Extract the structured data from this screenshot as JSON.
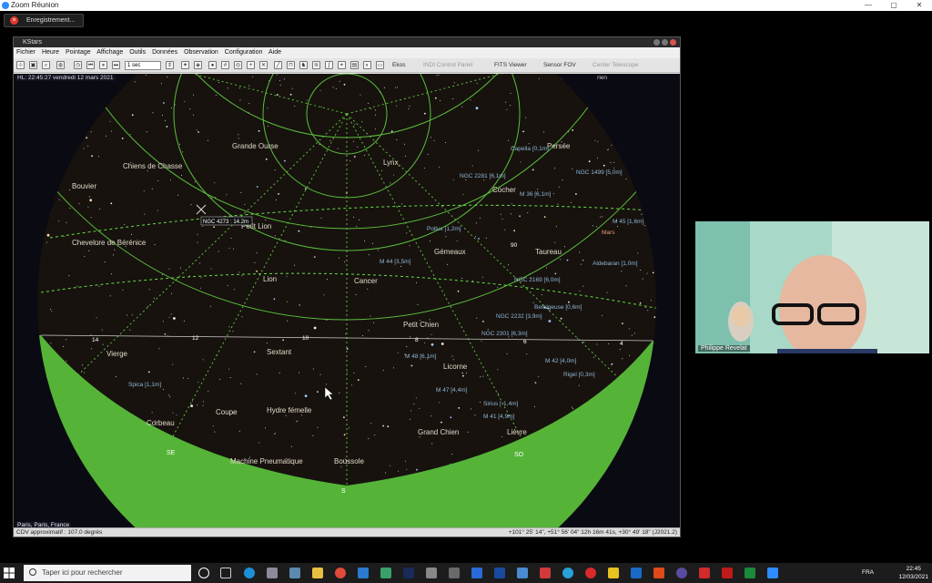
{
  "zoom": {
    "title": "Zoom Réunion",
    "recording_label": "Enregistrement..."
  },
  "kstars": {
    "title": "KStars",
    "menu": [
      "Fichier",
      "Heure",
      "Pointage",
      "Affichage",
      "Outils",
      "Données",
      "Observation",
      "Configuration",
      "Aide"
    ],
    "toolbar": {
      "time_step": "1 sec",
      "ekos": "Ekos",
      "indi": "INDI Control Panel",
      "fits": "FITS Viewer",
      "sensor_fov": "Sensor FOV",
      "center_telescope": "Center Telescope"
    },
    "hud": {
      "time": "HL: 22:45:27   vendredi 12 mars 2021",
      "object": "rien",
      "location": "Paris, Paris, France"
    },
    "status": {
      "fov": "CDV approximatif : 107.0 degrés",
      "coords": "+101° 25' 14\", +51° 56' 04\"  12h 16m 41s, +30° 49' 18\" (J2021.2)"
    },
    "sky_labels": {
      "constellations": [
        "Grande Ourse",
        "Chiens de Chasse",
        "Bouvier",
        "Chevelure de Bérénice",
        "Petit Lion",
        "Lion",
        "Cancer",
        "Gémeaux",
        "Lynx",
        "Cocher",
        "Persée",
        "Taureau",
        "Petit Chien",
        "Sextant",
        "Vierge",
        "Licorne",
        "Corbeau",
        "Coupe",
        "Hydre femelle",
        "Grand Chien",
        "Lièvre",
        "Machine Pneumatique",
        "Boussole"
      ],
      "objects": [
        "Capella [0,1m]",
        "NGC 2281 [6,1m]",
        "M 36 [6,1m]",
        "NGC 1499 [5,0m]",
        "M 45 [1,6m]",
        "Mars",
        "Pollux [1,2m]",
        "M 44 [3,5m]",
        "Aldebaran [1,0m]",
        "NGC 2169 [6,0m]",
        "Betelgeuse [0,6m]",
        "NGC 2232 [3,9m]",
        "NGC 2301 [6,3m]",
        "M 42 [4,0m]",
        "Rigel [0,3m]",
        "M 48 [6,1m]",
        "M 47 [4,4m]",
        "Sirius [-1,4m]",
        "M 41 [4,9m]",
        "Spica [1,1m]"
      ],
      "target": "NGC 4273 : 14.2m",
      "hour_ticks": [
        "14",
        "12",
        "10",
        "8",
        "6",
        "4"
      ],
      "grid_value": "90",
      "directions": [
        "SE",
        "S",
        "SO"
      ]
    }
  },
  "video": {
    "participant": "Philippe Revelat"
  },
  "taskbar": {
    "search_placeholder": "Taper ici pour rechercher",
    "lang": "FRA",
    "time": "22:45",
    "date": "12/03/2021"
  }
}
